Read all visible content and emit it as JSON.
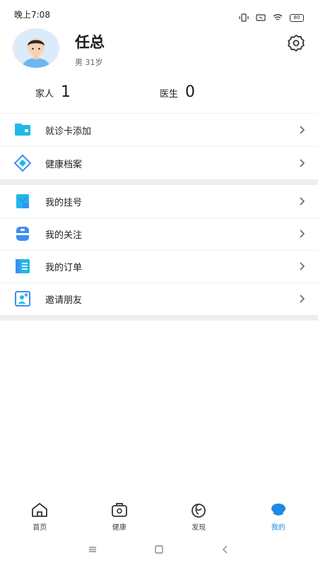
{
  "status": {
    "time": "晚上7:08",
    "battery": "80"
  },
  "profile": {
    "name": "任总",
    "subtitle": "男 31岁"
  },
  "stats": [
    {
      "label": "家人",
      "value": "1"
    },
    {
      "label": "医生",
      "value": "0"
    }
  ],
  "menu_group_1": [
    {
      "label": "就诊卡添加",
      "icon": "card-icon"
    },
    {
      "label": "健康档案",
      "icon": "diamond-icon"
    }
  ],
  "menu_group_2": [
    {
      "label": "我的挂号",
      "icon": "register-icon"
    },
    {
      "label": "我的关注",
      "icon": "follow-icon"
    },
    {
      "label": "我的订单",
      "icon": "order-icon"
    },
    {
      "label": "邀请朋友",
      "icon": "invite-icon"
    }
  ],
  "tabs": [
    {
      "label": "首页",
      "icon": "home-icon",
      "active": false
    },
    {
      "label": "健康",
      "icon": "health-icon",
      "active": false
    },
    {
      "label": "发现",
      "icon": "discover-icon",
      "active": false
    },
    {
      "label": "我的",
      "icon": "profile-tab-icon",
      "active": true
    }
  ],
  "colors": {
    "accent": "#1e88e5",
    "icon_blue": "#3d8ff2",
    "icon_cyan": "#20b8e8"
  }
}
